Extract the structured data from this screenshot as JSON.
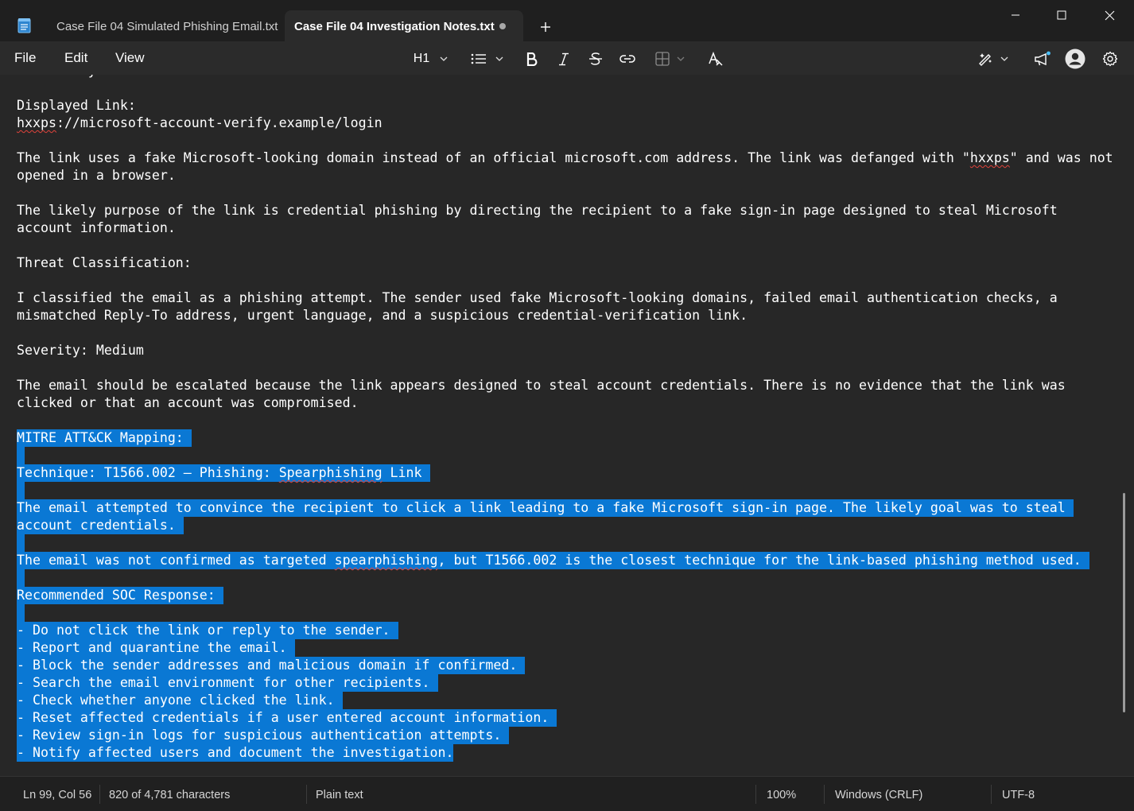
{
  "tabs": [
    {
      "label": "Case File 04 Simulated Phishing Email.txt",
      "active": false
    },
    {
      "label": "Case File 04 Investigation Notes.txt",
      "active": true,
      "unsaved": true
    }
  ],
  "menu": {
    "file": "File",
    "edit": "Edit",
    "view": "View"
  },
  "toolbar": {
    "heading_label": "H1"
  },
  "icons": [
    "notepad-app-icon",
    "new-tab-icon",
    "minimize-icon",
    "maximize-icon",
    "close-icon",
    "heading-dropdown-icon",
    "list-icon",
    "bold-icon",
    "italic-icon",
    "strikethrough-icon",
    "link-icon",
    "table-icon",
    "clear-formatting-icon",
    "copilot-rewrite-icon",
    "announcements-icon",
    "account-avatar-icon",
    "settings-icon"
  ],
  "colors": {
    "selection": "#0a78d4",
    "background": "#272727",
    "spellcheck": "#e0433b"
  },
  "document": {
    "lines": [
      {
        "text": "Link Analysis:"
      },
      {
        "text": ""
      },
      {
        "text": "Displayed Link:"
      },
      {
        "text": "hxxps://microsoft-account-verify.example/login"
      },
      {
        "text": ""
      },
      {
        "text": "The link uses a fake Microsoft-looking domain instead of an official microsoft.com address. The link was defanged with \"hxxps\" and was not"
      },
      {
        "text": "opened in a browser."
      },
      {
        "text": ""
      },
      {
        "text": "The likely purpose of the link is credential phishing by directing the recipient to a fake sign-in page designed to steal Microsoft"
      },
      {
        "text": "account information."
      },
      {
        "text": ""
      },
      {
        "text": "Threat Classification:"
      },
      {
        "text": ""
      },
      {
        "text": "I classified the email as a phishing attempt. The sender used fake Microsoft-looking domains, failed email authentication checks, a"
      },
      {
        "text": "mismatched Reply-To address, urgent language, and a suspicious credential-verification link."
      },
      {
        "text": ""
      },
      {
        "text": "Severity: Medium"
      },
      {
        "text": ""
      },
      {
        "text": "The email should be escalated because the link appears designed to steal account credentials. There is no evidence that the link was"
      },
      {
        "text": "clicked or that an account was compromised."
      },
      {
        "text": ""
      },
      {
        "text": "MITRE ATT&CK Mapping: ",
        "selected": true
      },
      {
        "text": "",
        "selected": true
      },
      {
        "text": "Technique: T1566.002 – Phishing: Spearphishing Link ",
        "selected": true
      },
      {
        "text": "",
        "selected": true
      },
      {
        "text": "The email attempted to convince the recipient to click a link leading to a fake Microsoft sign-in page. The likely goal was to steal ",
        "selected": true
      },
      {
        "text": "account credentials. ",
        "selected": true
      },
      {
        "text": "",
        "selected": true
      },
      {
        "text": "The email was not confirmed as targeted spearphishing, but T1566.002 is the closest technique for the link-based phishing method used. ",
        "selected": true
      },
      {
        "text": "",
        "selected": true
      },
      {
        "text": "Recommended SOC Response: ",
        "selected": true
      },
      {
        "text": "",
        "selected": true
      },
      {
        "text": "- Do not click the link or reply to the sender. ",
        "selected": true
      },
      {
        "text": "- Report and quarantine the email. ",
        "selected": true
      },
      {
        "text": "- Block the sender addresses and malicious domain if confirmed. ",
        "selected": true
      },
      {
        "text": "- Search the email environment for other recipients. ",
        "selected": true
      },
      {
        "text": "- Check whether anyone clicked the link. ",
        "selected": true
      },
      {
        "text": "- Reset affected credentials if a user entered account information. ",
        "selected": true
      },
      {
        "text": "- Review sign-in logs for suspicious authentication attempts. ",
        "selected": true
      },
      {
        "text": "- Notify affected users and document the investigation.",
        "selected": true
      }
    ],
    "misspelled_words": [
      "hxxps",
      "Spearphishing",
      "spearphishing"
    ]
  },
  "status": {
    "position": "Ln 99, Col 56",
    "characters": "820 of 4,781 characters",
    "format": "Plain text",
    "zoom": "100%",
    "line_ending": "Windows (CRLF)",
    "encoding": "UTF-8"
  }
}
